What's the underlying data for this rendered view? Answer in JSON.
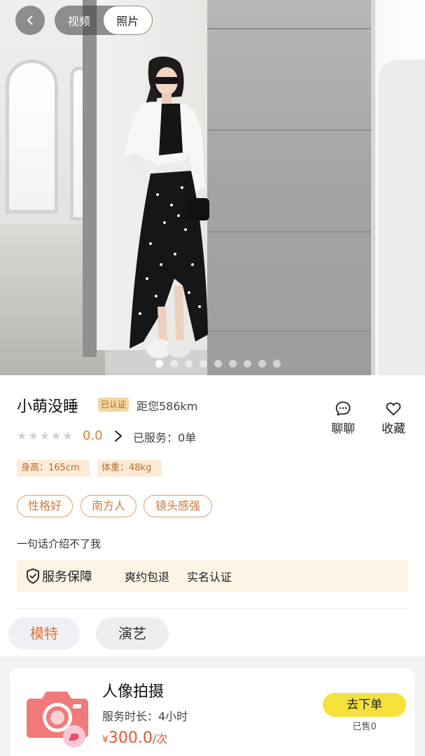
{
  "media_toggle": {
    "video": "视频",
    "photo": "照片",
    "selected": "照片"
  },
  "gallery": {
    "total": 9,
    "current": 1
  },
  "profile": {
    "name": "小萌没睡",
    "verified_badge": "已认证",
    "distance": "距您586km",
    "rating_stars": 0,
    "rating": "0.0",
    "served": "已服务：0单",
    "attributes": [
      "身高：165cm",
      "体重：48kg"
    ],
    "tags": [
      "性格好",
      "南方人",
      "镜头感强"
    ],
    "bio": "一句话介绍不了我"
  },
  "actions": {
    "chat": "聊聊",
    "favorite": "收藏"
  },
  "guarantee": {
    "title": "服务保障",
    "items": [
      "爽约包退",
      "实名认证"
    ]
  },
  "categories": {
    "items": [
      "模特",
      "演艺"
    ],
    "selected": "模特"
  },
  "service": {
    "title": "人像拍摄",
    "duration": "服务时长：4小时",
    "currency": "¥",
    "price": "300.0",
    "unit": "/次",
    "order_button": "去下单",
    "sold": "已售0"
  },
  "colors": {
    "accent_orange": "#d7843a",
    "order_button": "#f5e13c",
    "price_red": "#e0572b",
    "guarantee_bg": "#fdf4e6"
  },
  "icons": [
    "chevron-left-icon",
    "star-icon",
    "chevron-right-icon",
    "chat-bubble-icon",
    "heart-icon",
    "shield-check-icon",
    "camera-icon"
  ]
}
